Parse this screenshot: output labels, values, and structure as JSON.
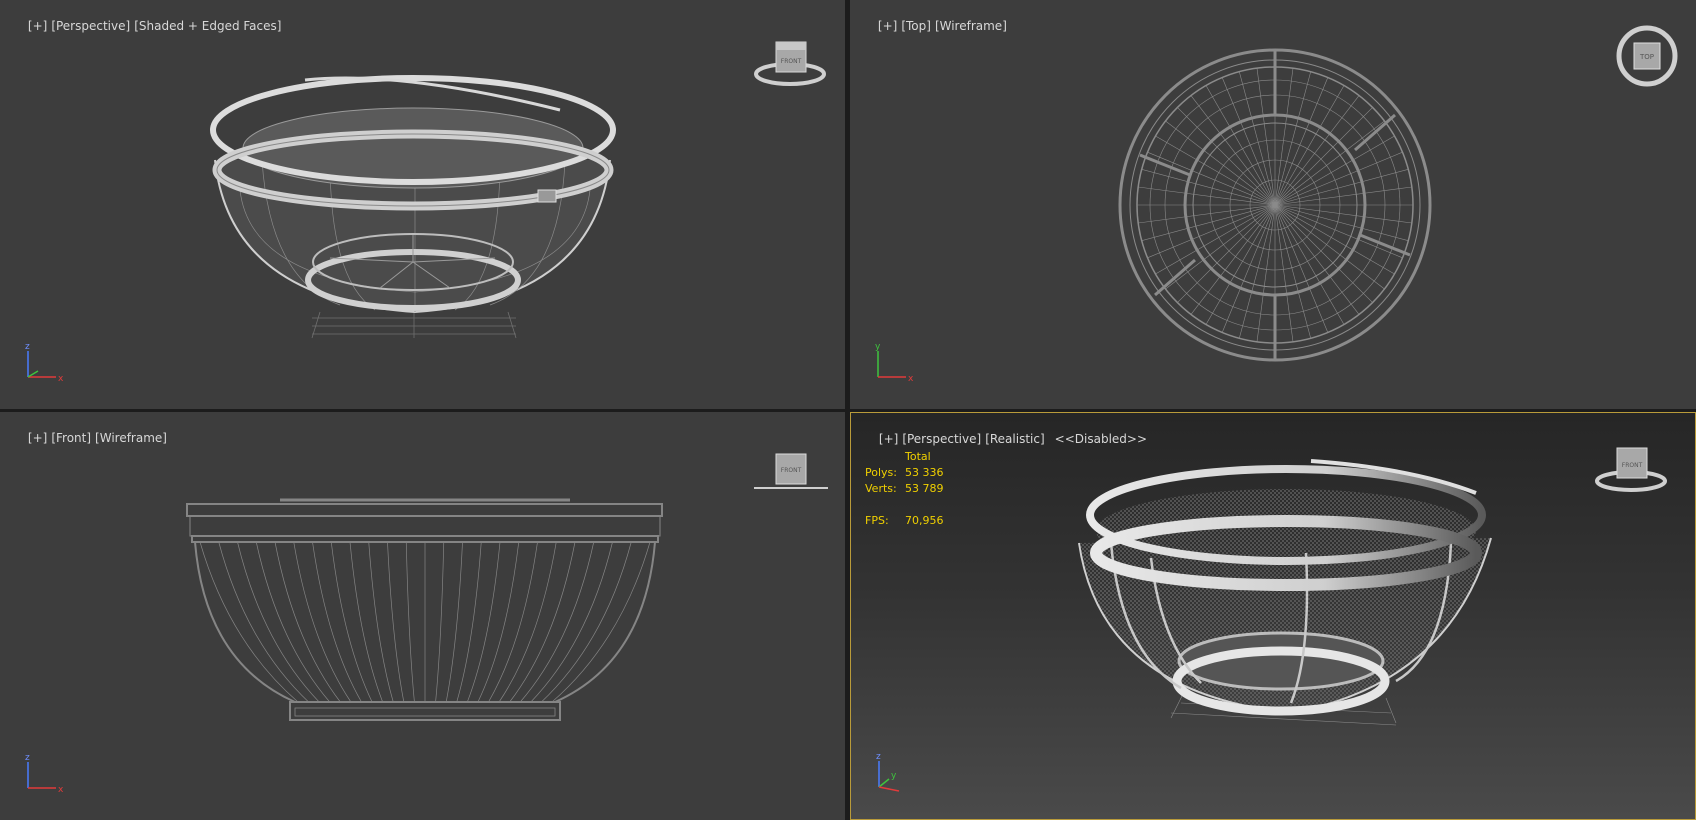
{
  "viewports": {
    "top_left": {
      "plus": "[+]",
      "view": "[Perspective]",
      "shading": "[Shaded + Edged Faces]",
      "cube_face": "FRONT",
      "axis_a": "z",
      "axis_b": "x"
    },
    "top_right": {
      "plus": "[+]",
      "view": "[Top]",
      "shading": "[Wireframe]",
      "cube_face": "TOP",
      "axis_a": "y",
      "axis_b": "x"
    },
    "bottom_left": {
      "plus": "[+]",
      "view": "[Front]",
      "shading": "[Wireframe]",
      "cube_face": "FRONT",
      "axis_a": "z",
      "axis_b": "x"
    },
    "bottom_right": {
      "plus": "[+]",
      "view": "[Perspective]",
      "shading": "[Realistic]",
      "status": "<<Disabled>>",
      "cube_face": "FRONT",
      "axis_a": "z",
      "axis_b": "y"
    }
  },
  "stats": {
    "header": "Total",
    "polys_label": "Polys:",
    "polys_value": "53 336",
    "verts_label": "Verts:",
    "verts_value": "53 789",
    "fps_label": "FPS:",
    "fps_value": "70,956"
  },
  "colors": {
    "viewport_bg": "#3d3d3d",
    "active_border": "#b99b3a",
    "stats_text": "#f0d000",
    "wire": "#a8a8a8"
  },
  "icons": [
    "viewcube-icon",
    "axis-tripod-icon"
  ]
}
